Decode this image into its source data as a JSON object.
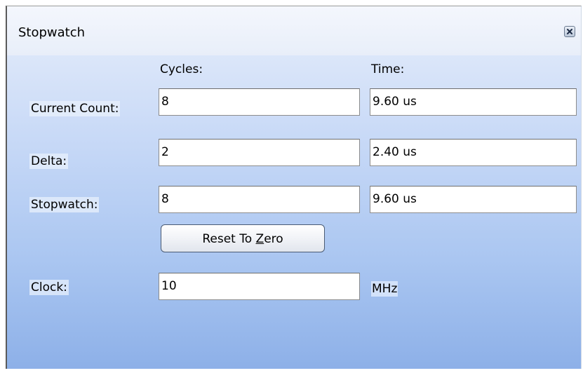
{
  "window": {
    "title": "Stopwatch",
    "close_icon": "close-icon"
  },
  "columns": {
    "cycles": "Cycles:",
    "time": "Time:"
  },
  "rows": {
    "current_count": {
      "label": "Current Count:",
      "cycles": "8",
      "time": "9.60 us"
    },
    "delta": {
      "label": "Delta:",
      "cycles": "2",
      "time": "2.40 us"
    },
    "stopwatch": {
      "label": "Stopwatch:",
      "cycles": "8",
      "time": "9.60 us"
    }
  },
  "reset_button": {
    "label_before": "Reset To ",
    "label_mnemonic": "Z",
    "label_after": "ero"
  },
  "clock": {
    "label": "Clock:",
    "value": "10",
    "unit": "MHz"
  }
}
